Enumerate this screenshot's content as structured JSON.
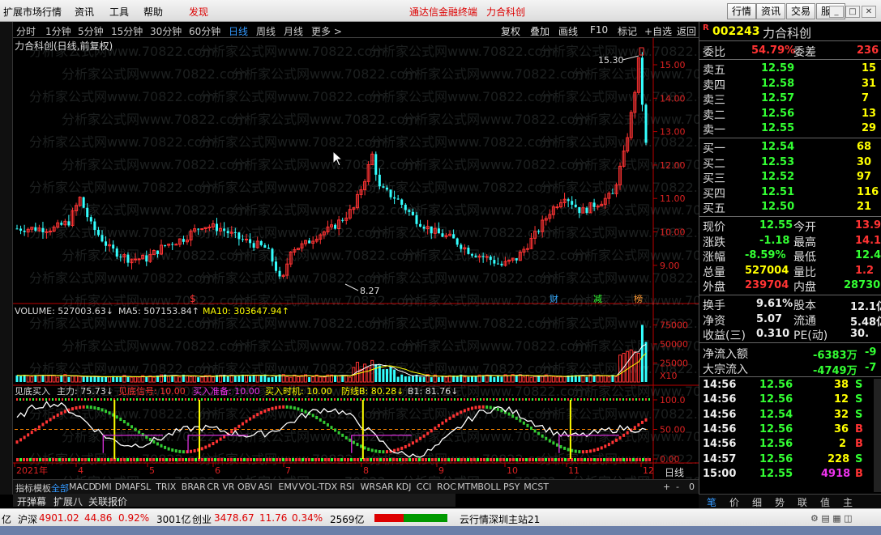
{
  "menu": {
    "items": [
      "扩展市场行情",
      "资讯",
      "工具",
      "帮助",
      "发现"
    ],
    "center1": "通达信金融终端",
    "center2": "力合科创",
    "right": [
      "行情",
      "资讯",
      "交易",
      "服务"
    ]
  },
  "periods": [
    "分时",
    "1分钟",
    "5分钟",
    "15分钟",
    "30分钟",
    "60分钟",
    "日线",
    "周线",
    "月线",
    "更多 >"
  ],
  "toolbar": [
    "复权",
    "叠加",
    "画线",
    "F10",
    "标记",
    "+自选",
    "返回"
  ],
  "chart": {
    "title": "力合科创(日线,前复权)",
    "price_ticks": [
      "15.00",
      "14.00",
      "13.00",
      "12.00",
      "11.00",
      "10.00",
      "9.00"
    ],
    "high_label": "15.30",
    "low_label": "8.27",
    "vol_ticks": [
      "75000",
      "50000",
      "25000"
    ],
    "vol_unit": "X10",
    "ind_ticks": [
      "100.0",
      "50.00",
      "0.00"
    ],
    "months": [
      "2021年",
      "4",
      "5",
      "6",
      "7",
      "8",
      "9",
      "10",
      "11",
      "12"
    ],
    "period_label": "日线",
    "markers": {
      "s": "$",
      "cai": "财",
      "jian": "减",
      "bang": "榜"
    },
    "watermark": "分析家公式网www.70822.com"
  },
  "vol_legend": {
    "vol": "VOLUME: 527003.63↓",
    "ma5": "MA5: 507153.84↑",
    "ma10": "MA10: 303647.94↑"
  },
  "ind_legend": {
    "a": "见底买入",
    "b": "主力: 75.73↓",
    "c": "见底信号: 10.00",
    "d": "买入准备: 10.00",
    "e": "买入时机: 10.00",
    "f": "防线B: 80.28↓",
    "g": "B1: 81.76↓"
  },
  "ind_tabs": [
    "指标",
    "模板",
    "全部",
    "MACD",
    "DMI",
    "DMA",
    "FSL",
    "TRIX",
    "BRAR",
    "CR",
    "VR",
    "OBV",
    "ASI",
    "EMV",
    "VOL-TDX",
    "RSI",
    "WR",
    "SAR",
    "KDJ",
    "CCI",
    "ROC",
    "MTM",
    "BOLL",
    "PSY",
    "MCST"
  ],
  "ind_tab_ctrl": [
    "+",
    "-",
    "0"
  ],
  "bottom_tabs": [
    "开弹幕",
    "扩展八",
    "关联报价"
  ],
  "quote": {
    "code": "002243",
    "name": "力合科创",
    "wb": "委比",
    "wb_v": "54.79%",
    "wc": "委差",
    "wc_v": "236",
    "asks": [
      {
        "l": "卖五",
        "p": "12.59",
        "q": "15"
      },
      {
        "l": "卖四",
        "p": "12.58",
        "q": "31"
      },
      {
        "l": "卖三",
        "p": "12.57",
        "q": "7"
      },
      {
        "l": "卖二",
        "p": "12.56",
        "q": "13"
      },
      {
        "l": "卖一",
        "p": "12.55",
        "q": "29"
      }
    ],
    "bids": [
      {
        "l": "买一",
        "p": "12.54",
        "q": "68"
      },
      {
        "l": "买二",
        "p": "12.53",
        "q": "30"
      },
      {
        "l": "买三",
        "p": "12.52",
        "q": "97"
      },
      {
        "l": "买四",
        "p": "12.51",
        "q": "116"
      },
      {
        "l": "买五",
        "p": "12.50",
        "q": "21"
      }
    ],
    "info": [
      {
        "l1": "现价",
        "v1": "12.55",
        "c1": "g",
        "l2": "今开",
        "v2": "13.9",
        "c2": "r"
      },
      {
        "l1": "涨跌",
        "v1": "-1.18",
        "c1": "g",
        "l2": "最高",
        "v2": "14.1",
        "c2": "r"
      },
      {
        "l1": "涨幅",
        "v1": "-8.59%",
        "c1": "g",
        "l2": "最低",
        "v2": "12.4",
        "c2": "g"
      },
      {
        "l1": "总量",
        "v1": "527004",
        "c1": "y",
        "l2": "量比",
        "v2": "1.2",
        "c2": "r"
      },
      {
        "l1": "外盘",
        "v1": "239704",
        "c1": "r",
        "l2": "内盘",
        "v2": "28730",
        "c2": "g"
      }
    ],
    "info2": [
      {
        "l1": "换手",
        "v1": "9.61%",
        "l2": "股本",
        "v2": "12.1亿"
      },
      {
        "l1": "净资",
        "v1": "5.07",
        "l2": "流通",
        "v2": "5.48亿"
      },
      {
        "l1": "收益(三)",
        "v1": "0.310",
        "l2": "PE(动)",
        "v2": "30."
      }
    ],
    "flows": [
      {
        "l": "净流入额",
        "v": "-6383万",
        "v2": "-9"
      },
      {
        "l": "大宗流入",
        "v": "-4749万",
        "v2": "-7"
      }
    ],
    "ticks": [
      {
        "t": "14:56",
        "p": "12.56",
        "q": "38",
        "s": "S"
      },
      {
        "t": "14:56",
        "p": "12.56",
        "q": "12",
        "s": "S"
      },
      {
        "t": "14:56",
        "p": "12.54",
        "q": "32",
        "s": "S"
      },
      {
        "t": "14:56",
        "p": "12.56",
        "q": "36",
        "s": "B"
      },
      {
        "t": "14:56",
        "p": "12.56",
        "q": "2",
        "s": "B"
      },
      {
        "t": "14:57",
        "p": "12.56",
        "q": "228",
        "s": "S"
      },
      {
        "t": "15:00",
        "p": "12.55",
        "q": "4918",
        "s": "B"
      }
    ]
  },
  "rp_tabs": [
    "笔",
    "价",
    "细",
    "势",
    "联",
    "值",
    "主"
  ],
  "status": {
    "cy_label": "亿",
    "sh": "沪深",
    "sh_v": "4901.02",
    "sh_c": "44.86",
    "sh_p": "0.92%",
    "sh_a": "3001亿",
    "cy": "创业",
    "cy_v": "3478.67",
    "cy_c": "11.76",
    "cy_p": "0.34%",
    "cy_a": "2569亿",
    "server": "云行情深圳主站21"
  }
}
